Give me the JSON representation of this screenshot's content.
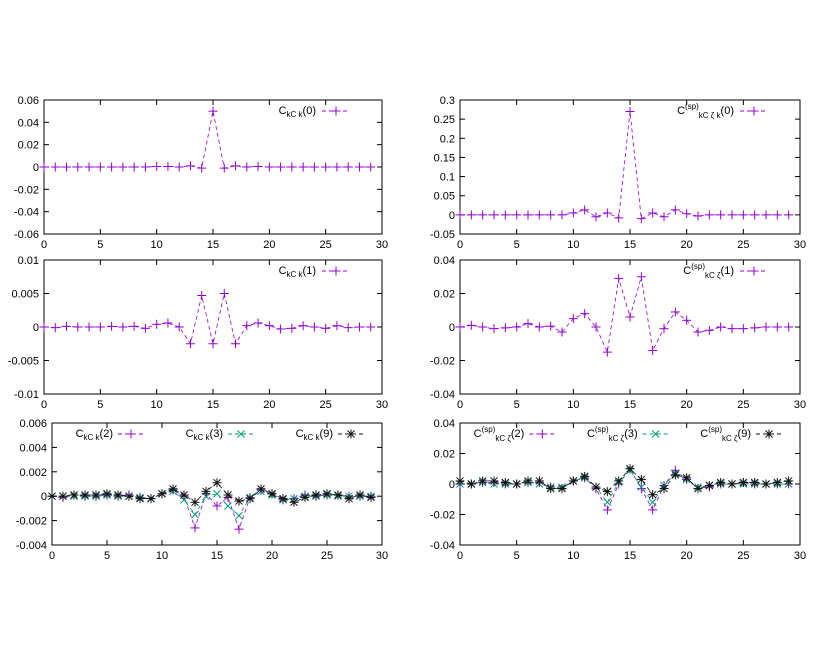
{
  "chart_data": [
    {
      "type": "line",
      "xlim": [
        0,
        30
      ],
      "ylim": [
        -0.06,
        0.06
      ],
      "xticks": [
        0,
        5,
        10,
        15,
        20,
        25,
        30
      ],
      "yticks": [
        -0.06,
        -0.04,
        -0.02,
        0,
        0.02,
        0.04,
        0.06
      ],
      "ytick_labels": [
        "-0.06",
        "-0.04",
        "-0.02",
        "0",
        "0.02",
        "0.04",
        "0.06"
      ],
      "grid": false,
      "legend_position": "top-right",
      "series": [
        {
          "name": "C_{kC k}(0)",
          "color": "#9400d3",
          "marker": "plus",
          "x": [
            0,
            1,
            2,
            3,
            4,
            5,
            6,
            7,
            8,
            9,
            10,
            11,
            12,
            13,
            14,
            15,
            16,
            17,
            18,
            19,
            20,
            21,
            22,
            23,
            24,
            25,
            26,
            27,
            28,
            29
          ],
          "y": [
            0,
            0,
            0,
            0,
            0,
            0,
            0,
            0,
            0,
            0,
            0.0005,
            0.0005,
            0,
            0.001,
            -0.001,
            0.05,
            -0.001,
            0.001,
            0,
            0.0005,
            0,
            0,
            0,
            0,
            0,
            0,
            0,
            0,
            0,
            0
          ]
        }
      ]
    },
    {
      "type": "line",
      "xlim": [
        0,
        30
      ],
      "ylim": [
        -0.05,
        0.3
      ],
      "xticks": [
        0,
        5,
        10,
        15,
        20,
        25,
        30
      ],
      "yticks": [
        -0.05,
        0,
        0.05,
        0.1,
        0.15,
        0.2,
        0.25,
        0.3
      ],
      "ytick_labels": [
        "-0.05",
        "0",
        "0.05",
        "0.1",
        "0.15",
        "0.2",
        "0.25",
        "0.3"
      ],
      "grid": false,
      "legend_position": "top-right",
      "series": [
        {
          "name": "C^{(sp)}_{kC ζ k}(0)",
          "color": "#9400d3",
          "marker": "plus",
          "x": [
            0,
            1,
            2,
            3,
            4,
            5,
            6,
            7,
            8,
            9,
            10,
            11,
            12,
            13,
            14,
            15,
            16,
            17,
            18,
            19,
            20,
            21,
            22,
            23,
            24,
            25,
            26,
            27,
            28,
            29
          ],
          "y": [
            0,
            0,
            0,
            0,
            0,
            0,
            0,
            0,
            0,
            0,
            0.005,
            0.013,
            -0.005,
            0.005,
            -0.008,
            0.27,
            -0.01,
            0.005,
            -0.005,
            0.013,
            0.003,
            -0.003,
            0,
            0,
            0,
            0,
            0,
            0,
            0,
            0
          ]
        }
      ]
    },
    {
      "type": "line",
      "xlim": [
        0,
        30
      ],
      "ylim": [
        -0.01,
        0.01
      ],
      "xticks": [
        0,
        5,
        10,
        15,
        20,
        25,
        30
      ],
      "yticks": [
        -0.01,
        -0.005,
        0,
        0.005,
        0.01
      ],
      "ytick_labels": [
        "-0.01",
        "-0.005",
        "0",
        "0.005",
        "0.01"
      ],
      "grid": false,
      "legend_position": "top-right",
      "series": [
        {
          "name": "C_{kC k}(1)",
          "color": "#9400d3",
          "marker": "plus",
          "x": [
            0,
            1,
            2,
            3,
            4,
            5,
            6,
            7,
            8,
            9,
            10,
            11,
            12,
            13,
            14,
            15,
            16,
            17,
            18,
            19,
            20,
            21,
            22,
            23,
            24,
            25,
            26,
            27,
            28,
            29
          ],
          "y": [
            0,
            -0.0001,
            0.0001,
            0,
            0,
            0,
            0.0001,
            0,
            0.0001,
            -0.0002,
            0.0004,
            0.0006,
            0,
            -0.0025,
            0.0047,
            -0.0025,
            0.005,
            -0.0025,
            0.0002,
            0.0006,
            0.0002,
            -0.0003,
            -0.0002,
            0.0002,
            0,
            -0.0002,
            0.0002,
            -0.0001,
            0,
            0
          ]
        }
      ]
    },
    {
      "type": "line",
      "xlim": [
        0,
        30
      ],
      "ylim": [
        -0.04,
        0.04
      ],
      "xticks": [
        0,
        5,
        10,
        15,
        20,
        25,
        30
      ],
      "yticks": [
        -0.04,
        -0.02,
        0,
        0.02,
        0.04
      ],
      "ytick_labels": [
        "-0.04",
        "-0.02",
        "0",
        "0.02",
        "0.04"
      ],
      "grid": false,
      "legend_position": "top-right",
      "series": [
        {
          "name": "C^{(sp)}_{kC ζ}(1)",
          "color": "#9400d3",
          "marker": "plus",
          "x": [
            0,
            1,
            2,
            3,
            4,
            5,
            6,
            7,
            8,
            9,
            10,
            11,
            12,
            13,
            14,
            15,
            16,
            17,
            18,
            19,
            20,
            21,
            22,
            23,
            24,
            25,
            26,
            27,
            28,
            29
          ],
          "y": [
            0,
            0.001,
            0,
            -0.001,
            -0.0005,
            0,
            0.002,
            0,
            0.0005,
            -0.003,
            0.005,
            0.008,
            0,
            -0.015,
            0.029,
            0.006,
            0.03,
            -0.014,
            -0.001,
            0.009,
            0.004,
            -0.003,
            -0.002,
            0,
            -0.001,
            -0.001,
            -0.0005,
            0,
            0,
            0
          ]
        }
      ]
    },
    {
      "type": "line",
      "xlim": [
        0,
        30
      ],
      "ylim": [
        -0.004,
        0.006
      ],
      "xticks": [
        0,
        5,
        10,
        15,
        20,
        25,
        30
      ],
      "yticks": [
        -0.004,
        -0.002,
        0,
        0.002,
        0.004,
        0.006
      ],
      "ytick_labels": [
        "-0.004",
        "-0.002",
        "0",
        "0.002",
        "0.004",
        "0.006"
      ],
      "grid": false,
      "legend_position": "top",
      "series": [
        {
          "name": "C_{kC k}(2)",
          "color": "#9400d3",
          "marker": "plus",
          "x": [
            0,
            1,
            2,
            3,
            4,
            5,
            6,
            7,
            8,
            9,
            10,
            11,
            12,
            13,
            14,
            15,
            16,
            17,
            18,
            19,
            20,
            21,
            22,
            23,
            24,
            25,
            26,
            27,
            28,
            29
          ],
          "y": [
            0,
            -0.0001,
            0.0001,
            0,
            0,
            0.0001,
            0,
            0.0001,
            -0.0001,
            -0.0002,
            0.0002,
            0.0005,
            0,
            -0.0026,
            0.0002,
            -0.0008,
            -0.0001,
            -0.0027,
            -0.0001,
            0.0005,
            0.0002,
            -0.0003,
            -0.0002,
            0.0001,
            0,
            0.0001,
            0.0001,
            0,
            0,
            0
          ]
        },
        {
          "name": "C_{kC k}(3)",
          "color": "#009e73",
          "marker": "cross",
          "x": [
            0,
            1,
            2,
            3,
            4,
            5,
            6,
            7,
            8,
            9,
            10,
            11,
            12,
            13,
            14,
            15,
            16,
            17,
            18,
            19,
            20,
            21,
            22,
            23,
            24,
            25,
            26,
            27,
            28,
            29
          ],
          "y": [
            0,
            0,
            0,
            0,
            0,
            0.0001,
            0,
            0,
            -0.0001,
            -0.0002,
            0.0002,
            0.0004,
            -0.0003,
            -0.0015,
            0,
            0.0002,
            -0.0008,
            -0.0016,
            -0.0001,
            0.0004,
            0.0001,
            -0.0003,
            -0.0002,
            0,
            0,
            0.0001,
            0,
            0,
            0,
            0
          ]
        },
        {
          "name": "C_{kC k}(9)",
          "color": "#111111",
          "marker": "star",
          "x": [
            0,
            1,
            2,
            3,
            4,
            5,
            6,
            7,
            8,
            9,
            10,
            11,
            12,
            13,
            14,
            15,
            16,
            17,
            18,
            19,
            20,
            21,
            22,
            23,
            24,
            25,
            26,
            27,
            28,
            29
          ],
          "y": [
            0,
            0,
            0.0001,
            0.0001,
            0.0001,
            0.0002,
            0.0001,
            0,
            -0.0002,
            -0.0002,
            0.0002,
            0.0006,
            0.0001,
            -0.0005,
            0.0004,
            0.0011,
            0.0001,
            -0.0004,
            -0.0002,
            0.0006,
            0.0002,
            -0.0002,
            -0.0005,
            -0.0001,
            0.0001,
            0.0002,
            0.0001,
            -0.0002,
            0.0001,
            -0.0001
          ]
        }
      ]
    },
    {
      "type": "line",
      "xlim": [
        0,
        30
      ],
      "ylim": [
        -0.04,
        0.04
      ],
      "xticks": [
        0,
        5,
        10,
        15,
        20,
        25,
        30
      ],
      "yticks": [
        -0.04,
        -0.02,
        0,
        0.02,
        0.04
      ],
      "ytick_labels": [
        "-0.04",
        "-0.02",
        "0",
        "0.02",
        "0.04"
      ],
      "grid": false,
      "legend_position": "top",
      "series": [
        {
          "name": "C^{(sp)}_{kC ζ}(2)",
          "color": "#9400d3",
          "marker": "plus",
          "x": [
            0,
            1,
            2,
            3,
            4,
            5,
            6,
            7,
            8,
            9,
            10,
            11,
            12,
            13,
            14,
            15,
            16,
            17,
            18,
            19,
            20,
            21,
            22,
            23,
            24,
            25,
            26,
            27,
            28,
            29
          ],
          "y": [
            0,
            0,
            0.001,
            0.001,
            0,
            0,
            0.001,
            0.001,
            -0.002,
            -0.003,
            0.002,
            0.004,
            -0.003,
            -0.017,
            0,
            0.01,
            -0.003,
            -0.017,
            -0.001,
            0.009,
            0.003,
            -0.003,
            -0.002,
            0,
            0,
            0.001,
            0,
            0,
            0,
            0
          ]
        },
        {
          "name": "C^{(sp)}_{kC ζ}(3)",
          "color": "#009e73",
          "marker": "cross",
          "x": [
            0,
            1,
            2,
            3,
            4,
            5,
            6,
            7,
            8,
            9,
            10,
            11,
            12,
            13,
            14,
            15,
            16,
            17,
            18,
            19,
            20,
            21,
            22,
            23,
            24,
            25,
            26,
            27,
            28,
            29
          ],
          "y": [
            0,
            0,
            0.001,
            0,
            0,
            0,
            0.001,
            0,
            -0.002,
            -0.002,
            0.002,
            0.004,
            -0.002,
            -0.012,
            0.001,
            0.009,
            -0.002,
            -0.012,
            -0.001,
            0.007,
            0.003,
            -0.002,
            -0.001,
            0,
            0,
            0,
            0,
            0,
            0,
            0
          ]
        },
        {
          "name": "C^{(sp)}_{kC ζ}(9)",
          "color": "#111111",
          "marker": "star",
          "x": [
            0,
            1,
            2,
            3,
            4,
            5,
            6,
            7,
            8,
            9,
            10,
            11,
            12,
            13,
            14,
            15,
            16,
            17,
            18,
            19,
            20,
            21,
            22,
            23,
            24,
            25,
            26,
            27,
            28,
            29
          ],
          "y": [
            0.002,
            0,
            0.002,
            0.002,
            0.001,
            0,
            0.002,
            0.002,
            -0.003,
            -0.003,
            0.002,
            0.005,
            -0.002,
            -0.005,
            0.002,
            0.01,
            0.003,
            -0.007,
            -0.003,
            0.006,
            0.004,
            -0.003,
            -0.001,
            0.001,
            0,
            0.001,
            0.001,
            0,
            0.001,
            0.002
          ]
        }
      ]
    }
  ]
}
